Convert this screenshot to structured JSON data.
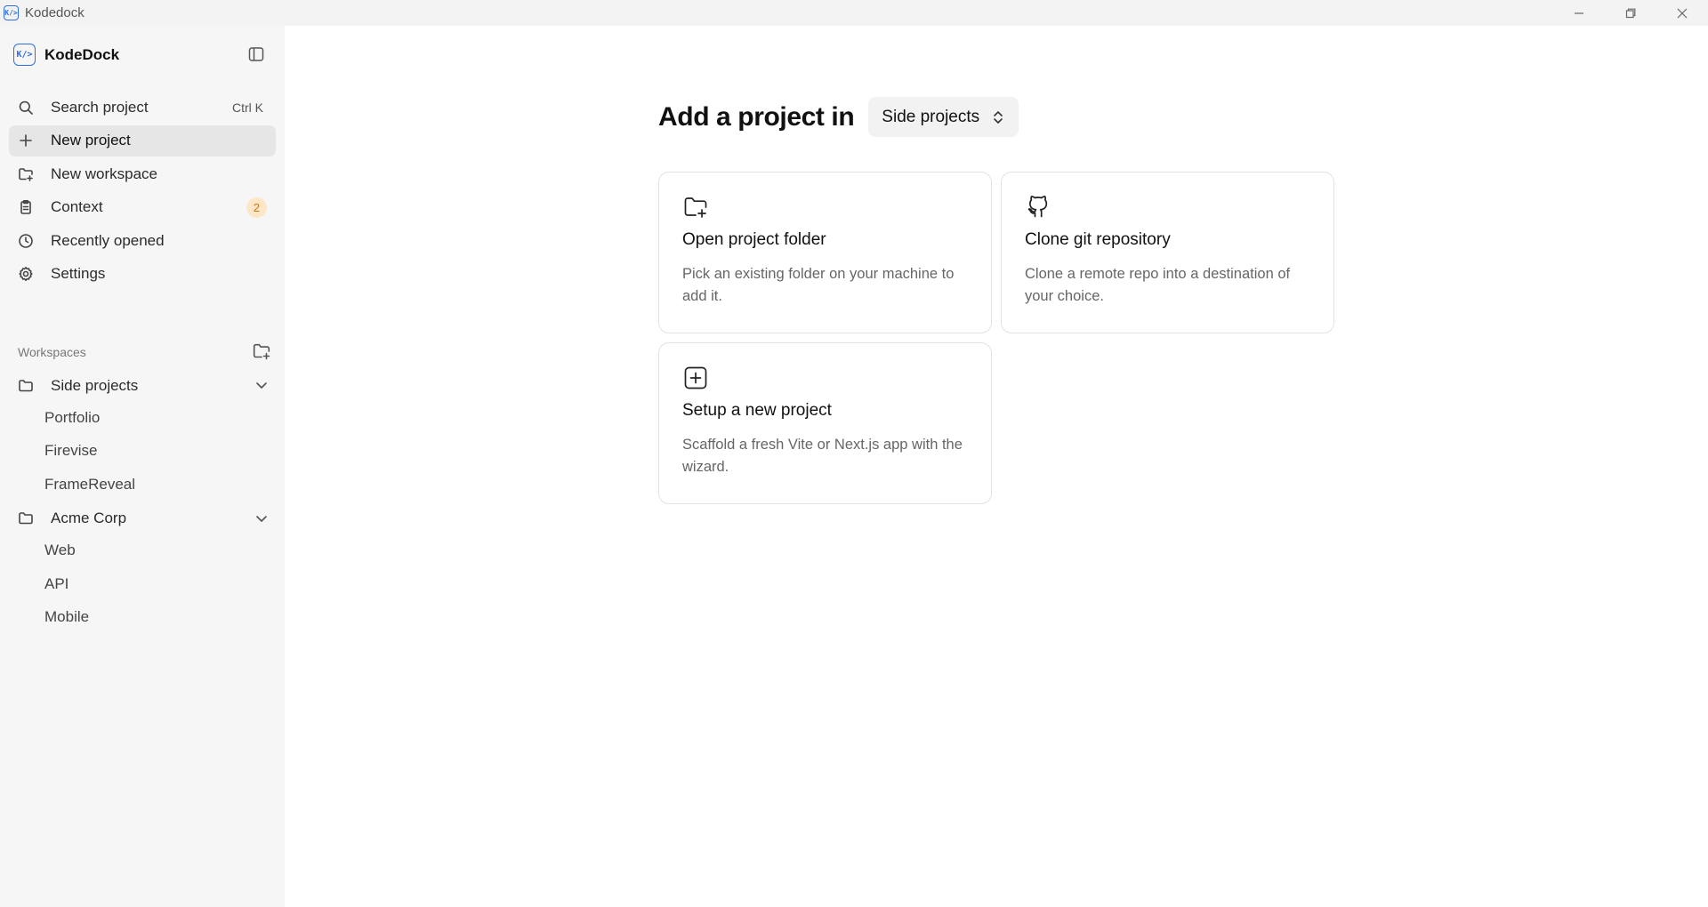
{
  "window": {
    "title": "Kodedock",
    "icon_text": "K/>",
    "controls": [
      "minimize-icon",
      "restore-icon",
      "close-icon"
    ]
  },
  "sidebar": {
    "brand": {
      "name": "KodeDock",
      "logo_text": "K/>"
    },
    "toggle_icon": "sidebar-panel-icon",
    "nav": [
      {
        "label": "Search project",
        "icon": "search-icon",
        "shortcut": "Ctrl K"
      },
      {
        "label": "New project",
        "icon": "plus-icon",
        "active": true
      },
      {
        "label": "New workspace",
        "icon": "folder-plus-icon"
      },
      {
        "label": "Context",
        "icon": "clipboard-icon",
        "badge": "2"
      },
      {
        "label": "Recently opened",
        "icon": "clock-icon"
      },
      {
        "label": "Settings",
        "icon": "gear-icon"
      }
    ],
    "workspaces_label": "Workspaces",
    "workspaces": [
      {
        "name": "Side projects",
        "expanded": true,
        "projects": [
          "Portfolio",
          "Firevise",
          "FrameReveal"
        ]
      },
      {
        "name": "Acme Corp",
        "expanded": true,
        "projects": [
          "Web",
          "API",
          "Mobile"
        ]
      }
    ]
  },
  "main": {
    "heading": "Add a project in",
    "workspace_select": {
      "value": "Side projects"
    },
    "cards": [
      {
        "title": "Open project folder",
        "description": "Pick an existing folder on your machine to add it.",
        "icon": "folder-plus-icon"
      },
      {
        "title": "Clone git repository",
        "description": "Clone a remote repo into a destination of your choice.",
        "icon": "github-icon"
      },
      {
        "title": "Setup a new project",
        "description": "Scaffold a fresh Vite or Next.js app with the wizard.",
        "icon": "plus-square-icon"
      }
    ]
  },
  "colors": {
    "accent": "#2f6fe0",
    "sidebar_bg": "#f6f6f6",
    "active_item_bg": "#e6e6e6",
    "badge_bg": "#fde7c8",
    "badge_text": "#c07a14"
  }
}
